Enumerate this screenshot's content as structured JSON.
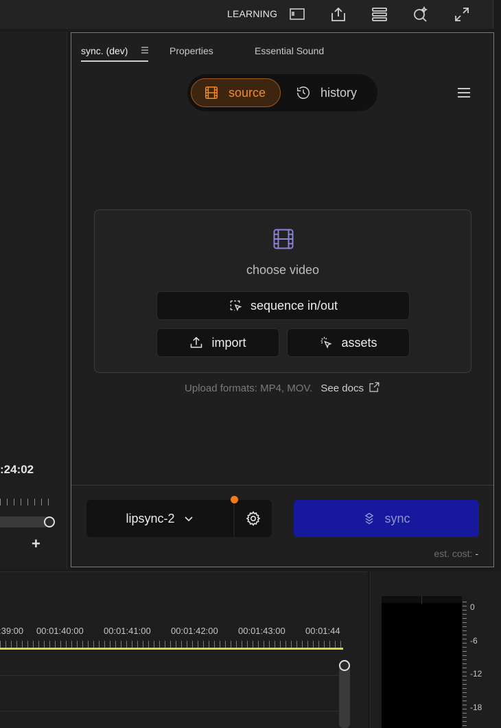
{
  "topbar": {
    "workspace_label": "LEARNING",
    "icons": [
      "panel-icon",
      "export-icon",
      "settings-sliders-icon",
      "search-sparkle-icon",
      "expand-icon"
    ]
  },
  "left_monitor": {
    "timecode": ":24:02",
    "add_label": "+"
  },
  "panel": {
    "tabs": [
      {
        "label": "sync. (dev)",
        "active": true
      },
      {
        "label": "Properties",
        "active": false
      },
      {
        "label": "Essential Sound",
        "active": false
      }
    ],
    "segment": {
      "source_label": "source",
      "history_label": "history",
      "selected": "source"
    },
    "dropzone": {
      "choose_label": "choose video",
      "sequence_label": "sequence in/out",
      "import_label": "import",
      "assets_label": "assets"
    },
    "formats_text": "Upload formats: MP4, MOV.",
    "docs_label": "See docs",
    "model_label": "lipsync-2",
    "sync_label": "sync",
    "cost_label": "est. cost:",
    "cost_value": "-"
  },
  "timeline": {
    "labels": [
      ":39:00",
      "00:01:40:00",
      "00:01:41:00",
      "00:01:42:00",
      "00:01:43:00",
      "00:01:44"
    ]
  },
  "meter": {
    "db_labels": [
      "0",
      "-6",
      "-12",
      "-18"
    ]
  },
  "colors": {
    "accent_orange": "#f08a2a",
    "sync_blue": "#16189e",
    "panel_border": "#4f7fc9",
    "playhead_yellow": "#d9d93a"
  }
}
